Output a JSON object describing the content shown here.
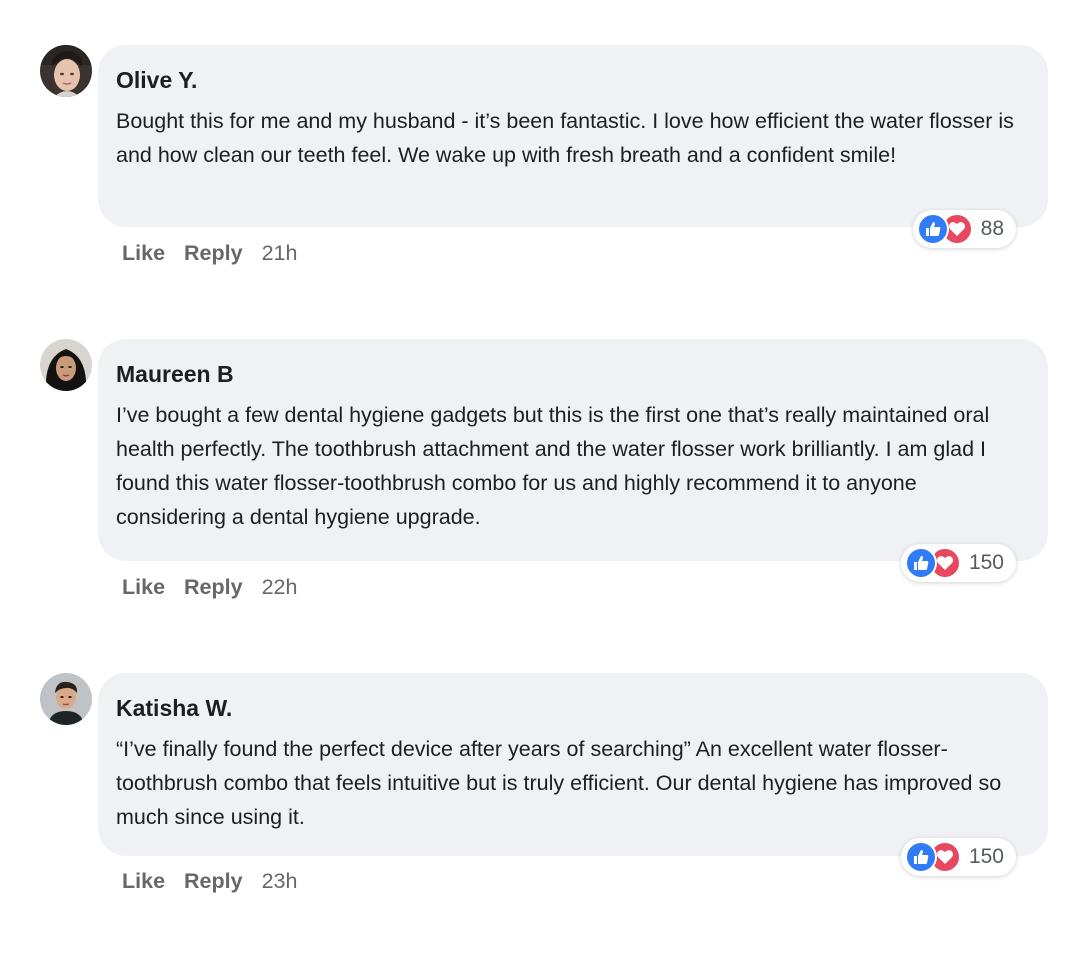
{
  "comments": [
    {
      "author": "Olive Y.",
      "text": "Bought this for me and my husband - it’s been fantastic. I love how efficient the water flosser is and how clean our teeth feel. We wake up with fresh breath and a confident smile!",
      "reaction_count": "88",
      "like_label": "Like",
      "reply_label": "Reply",
      "time": "21h"
    },
    {
      "author": "Maureen B",
      "text": "I’ve bought a few dental hygiene gadgets but this is the first one that’s really maintained oral health perfectly. The toothbrush attachment and the water flosser work brilliantly. I am glad I found this water flosser-toothbrush combo for us and highly recommend it to anyone considering a dental hygiene upgrade.",
      "reaction_count": "150",
      "like_label": "Like",
      "reply_label": "Reply",
      "time": "22h"
    },
    {
      "author": "Katisha W.",
      "text": "“I’ve finally found the perfect device after years of searching” An excellent water flosser-toothbrush combo that feels intuitive but is truly efficient. Our dental hygiene has improved so much since using it.",
      "reaction_count": "150",
      "like_label": "Like",
      "reply_label": "Reply",
      "time": "23h"
    }
  ],
  "icons": {
    "like": "thumbs-up-icon",
    "love": "heart-icon"
  },
  "colors": {
    "bubble": "#f0f1f5",
    "like_blue": "#2f7cf6",
    "love_red": "#e8485f",
    "meta_gray": "#65676b"
  }
}
